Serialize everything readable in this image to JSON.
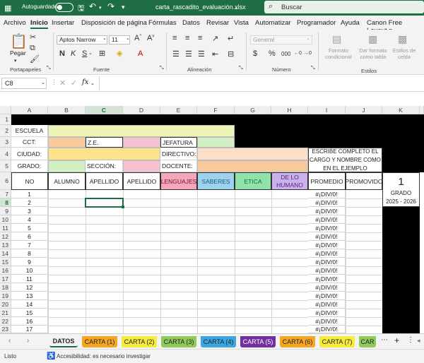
{
  "titlebar": {
    "autosave": "Autoguardado",
    "filename": "carta_rascadito_evaluación.xlsx",
    "search": "Buscar"
  },
  "menu": [
    "Archivo",
    "Inicio",
    "Insertar",
    "Disposición de página",
    "Fórmulas",
    "Datos",
    "Revisar",
    "Vista",
    "Automatizar",
    "Programador",
    "Ayuda",
    "Canon Free Layout p"
  ],
  "ribbon": {
    "paste": "Pegar",
    "clipboard": "Portapapeles",
    "font_name": "Aptos Narrow",
    "font_size": "11",
    "font_group": "Fuente",
    "align_group": "Alineación",
    "number_format": "General",
    "number_group": "Número",
    "cond_format": "Formato condicional",
    "table_format": "Dar formato como tabla",
    "cell_styles": "Estilos de celda",
    "styles_group": "Estilos"
  },
  "formula": {
    "namebox": "C8",
    "fx": "fx"
  },
  "columns": [
    "A",
    "B",
    "C",
    "D",
    "E",
    "F",
    "G",
    "H",
    "I",
    "J",
    "K"
  ],
  "rows": [
    "1",
    "2",
    "3",
    "4",
    "5",
    "6",
    "7",
    "8",
    "9",
    "10",
    "11",
    "12",
    "13",
    "14",
    "15",
    "16",
    "17",
    "18",
    "19",
    "20",
    "21",
    "22",
    "23"
  ],
  "sheet": {
    "escuela": "ESCUELA",
    "cct": "CCT:",
    "ze": "Z.E.",
    "jefatura": "JEFATURA",
    "ciudad": "CIUDAD:",
    "directivo": "DIRECTIVO:",
    "grado": "GRADO:",
    "seccion": "SECCIÓN:",
    "docente": "DOCENTE:",
    "note": "ESCRIBE COMPLETO EL CARGO Y NOMBRE COMO EN EL EJEMPLO",
    "headers": [
      "NO",
      "ALUMNO",
      "APELLIDO",
      "APELLIDO",
      "LENGUAJES",
      "SABERES",
      "ETICA",
      "DE LO HUMANO",
      "PROMEDIO",
      "PROMOVIDO"
    ],
    "big_number": "1",
    "grado_label": "GRADO",
    "year": "2025 - 2026",
    "numbers": [
      "1",
      "2",
      "3",
      "4",
      "5",
      "6",
      "7",
      "8",
      "9",
      "10",
      "11",
      "12",
      "13",
      "14",
      "15",
      "16",
      "17"
    ],
    "div_error": "#¡DIV/0!"
  },
  "tabs": [
    {
      "label": "DATOS",
      "bg": "#ffffff",
      "color": "#1f6e43"
    },
    {
      "label": "CARTA (1)",
      "bg": "#f5a623",
      "color": "#222"
    },
    {
      "label": "CARTA (2)",
      "bg": "#f7ec3b",
      "color": "#222"
    },
    {
      "label": "CARTA (3)",
      "bg": "#8fca5a",
      "color": "#222"
    },
    {
      "label": "CARTA (4)",
      "bg": "#3aa7e0",
      "color": "#222"
    },
    {
      "label": "CARTA (5)",
      "bg": "#7030a0",
      "color": "#fff"
    },
    {
      "label": "CARTA (6)",
      "bg": "#f5a623",
      "color": "#222"
    },
    {
      "label": "CARTA (7)",
      "bg": "#f7ec3b",
      "color": "#222"
    },
    {
      "label": "CAR",
      "bg": "#8fca5a",
      "color": "#222"
    }
  ],
  "status": {
    "ready": "Listo",
    "accessibility": "Accesibilidad: es necesario investigar"
  }
}
